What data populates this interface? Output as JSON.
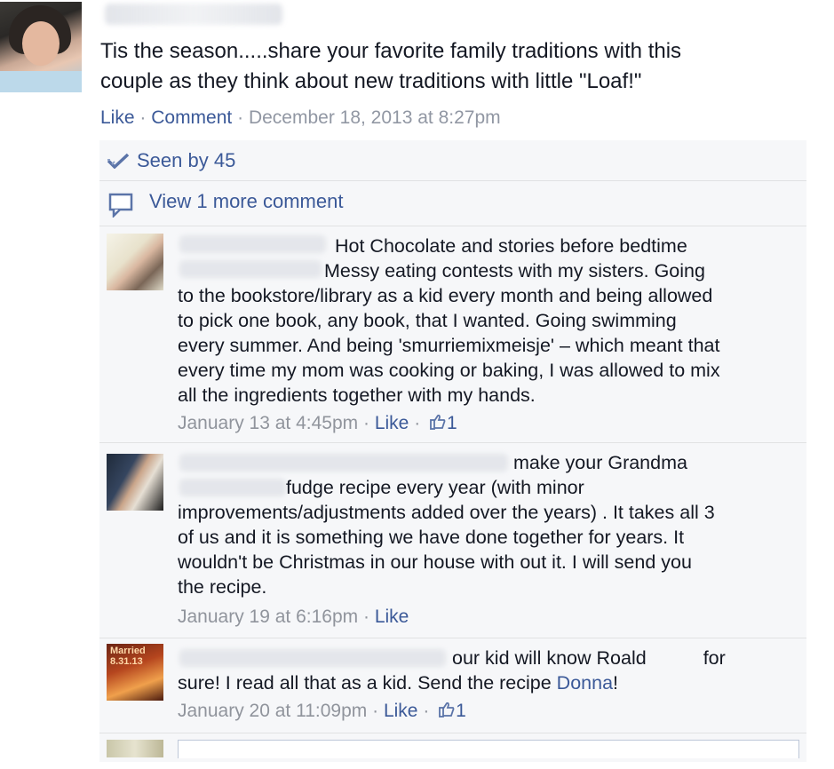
{
  "post": {
    "author_name": "",
    "text_line1": "Tis the season.....share your favorite family traditions with this",
    "text_line2": "couple as they think about new traditions with little \"Loaf!\"",
    "like_label": "Like",
    "comment_label": "Comment",
    "timestamp": "December 18, 2013 at 8:27pm"
  },
  "ufi": {
    "seen_label": "Seen by 45",
    "view_more_label": "View 1 more comment"
  },
  "comments": [
    {
      "lines": [
        "Hot Chocolate and stories before bedtime",
        "Messy eating contests with my sisters. Going",
        "to the bookstore/library as a kid every month and being allowed",
        "to pick one book, any book, that I wanted. Going swimming",
        "every summer. And being 'smurriemixmeisje' – which meant that",
        "every time my mom was cooking or baking, I was allowed to mix",
        "all the ingredients together with my hands."
      ],
      "timestamp": "January 13 at 4:45pm",
      "like_label": "Like",
      "like_count": "1"
    },
    {
      "lines": [
        "make your Grandma",
        "fudge recipe every year (with minor",
        "improvements/adjustments added over the years) . It takes all 3",
        "of us and it is something we have done together for years. It",
        "wouldn't be Christmas in our house with out it. I will send you",
        "the recipe."
      ],
      "timestamp": "January 19 at 6:16pm",
      "like_label": "Like"
    },
    {
      "line1_a": "our kid will know Roald",
      "line1_b": "for",
      "line2_text": "sure! I read all that as a kid. Send the recipe ",
      "line2_link": "Donna",
      "line2_end": "!",
      "avatar_text_1": "Married",
      "avatar_text_2": "8.31.13",
      "timestamp": "January 20 at 11:09pm",
      "like_label": "Like",
      "like_count": "1"
    }
  ],
  "colors": {
    "link": "#3b5998",
    "meta": "#9197a3",
    "ufi_bg": "#f6f7f9"
  }
}
